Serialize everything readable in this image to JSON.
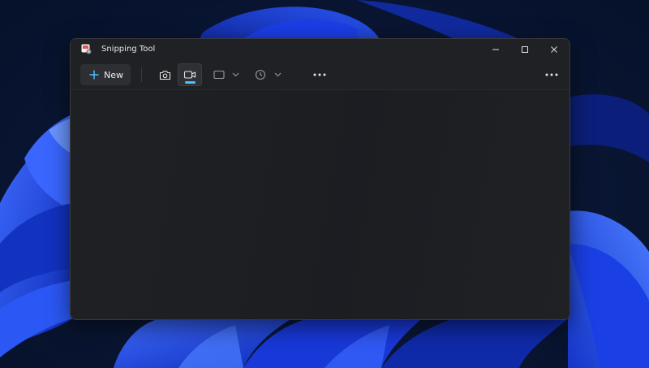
{
  "window": {
    "title": "Snipping Tool"
  },
  "toolbar": {
    "new_label": "New",
    "active_mode": "video"
  },
  "icons": {
    "app": "snipping-tool-icon",
    "new": "plus-icon",
    "photo": "camera-icon",
    "video": "video-camera-icon",
    "shape": "rectangle-shape-icon",
    "delay": "clock-icon",
    "chevron": "chevron-down-icon",
    "more": "more-horizontal-icon",
    "minimize": "minimize-icon",
    "maximize": "maximize-icon",
    "close": "close-icon"
  },
  "colors": {
    "accent": "#4cc2ff",
    "window_bg": "#202124",
    "wallpaper_blue": "#1f3fe0"
  }
}
